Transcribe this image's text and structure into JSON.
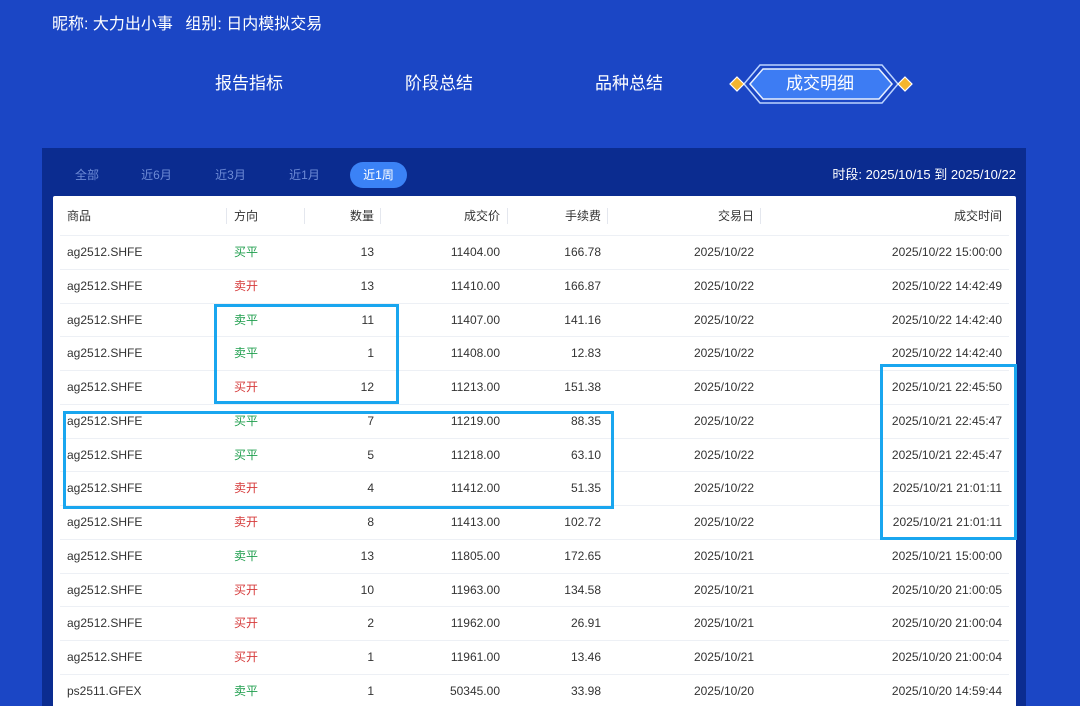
{
  "user_info": {
    "nickname_label": "昵称:",
    "nickname": "大力出小事",
    "group_label": "组别:",
    "group": "日内模拟交易"
  },
  "tabs": [
    {
      "label": "报告指标"
    },
    {
      "label": "阶段总结"
    },
    {
      "label": "品种总结"
    },
    {
      "label": "成交明细",
      "active": true
    }
  ],
  "filters": {
    "items": [
      "全部",
      "近6月",
      "近3月",
      "近1月",
      "近1周"
    ],
    "selected": "近1周"
  },
  "period": {
    "label": "时段:",
    "start": "2025/10/15",
    "separator": "到",
    "end": "2025/10/22"
  },
  "table": {
    "columns": [
      "商品",
      "方向",
      "数量",
      "成交价",
      "手续费",
      "交易日",
      "成交时间"
    ],
    "rows": [
      [
        "ag2512.SHFE",
        "买平",
        "13",
        "11404.00",
        "166.78",
        "2025/10/22",
        "2025/10/22 15:00:00"
      ],
      [
        "ag2512.SHFE",
        "卖开",
        "13",
        "11410.00",
        "166.87",
        "2025/10/22",
        "2025/10/22 14:42:49"
      ],
      [
        "ag2512.SHFE",
        "卖平",
        "11",
        "11407.00",
        "141.16",
        "2025/10/22",
        "2025/10/22 14:42:40"
      ],
      [
        "ag2512.SHFE",
        "卖平",
        "1",
        "11408.00",
        "12.83",
        "2025/10/22",
        "2025/10/22 14:42:40"
      ],
      [
        "ag2512.SHFE",
        "买开",
        "12",
        "11213.00",
        "151.38",
        "2025/10/22",
        "2025/10/21 22:45:50"
      ],
      [
        "ag2512.SHFE",
        "买平",
        "7",
        "11219.00",
        "88.35",
        "2025/10/22",
        "2025/10/21 22:45:47"
      ],
      [
        "ag2512.SHFE",
        "买平",
        "5",
        "11218.00",
        "63.10",
        "2025/10/22",
        "2025/10/21 22:45:47"
      ],
      [
        "ag2512.SHFE",
        "卖开",
        "4",
        "11412.00",
        "51.35",
        "2025/10/22",
        "2025/10/21 21:01:11"
      ],
      [
        "ag2512.SHFE",
        "卖开",
        "8",
        "11413.00",
        "102.72",
        "2025/10/22",
        "2025/10/21 21:01:11"
      ],
      [
        "ag2512.SHFE",
        "卖平",
        "13",
        "11805.00",
        "172.65",
        "2025/10/21",
        "2025/10/21 15:00:00"
      ],
      [
        "ag2512.SHFE",
        "买开",
        "10",
        "11963.00",
        "134.58",
        "2025/10/21",
        "2025/10/20 21:00:05"
      ],
      [
        "ag2512.SHFE",
        "买开",
        "2",
        "11962.00",
        "26.91",
        "2025/10/21",
        "2025/10/20 21:00:04"
      ],
      [
        "ag2512.SHFE",
        "买开",
        "1",
        "11961.00",
        "13.46",
        "2025/10/21",
        "2025/10/20 21:00:04"
      ],
      [
        "ps2511.GFEX",
        "卖平",
        "1",
        "50345.00",
        "33.98",
        "2025/10/20",
        "2025/10/20 14:59:44"
      ]
    ]
  },
  "colors": {
    "background": "#1b46c5",
    "panel": "#0b2c90",
    "accent": "#3b82f6",
    "filter_inactive": "#6e8bd6",
    "open_direction": "#d63b3b",
    "close_direction": "#1f9e4d",
    "highlight_box": "#19a6ef",
    "diamond": "#f4b52e"
  }
}
